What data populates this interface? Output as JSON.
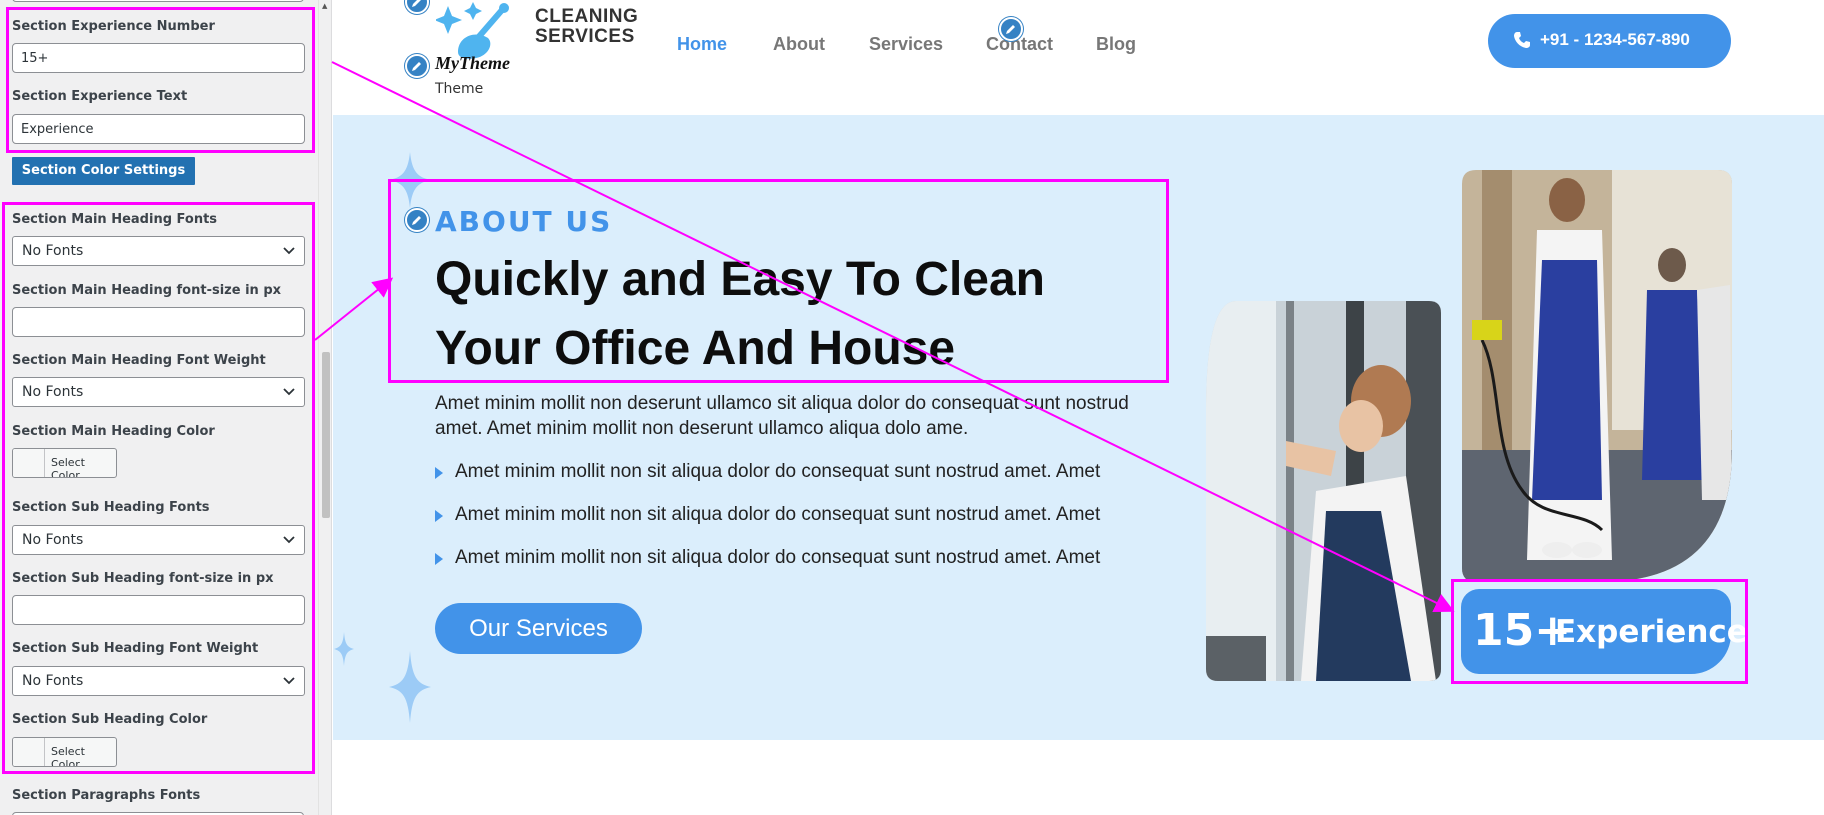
{
  "customizer": {
    "experience_number_label": "Section Experience Number",
    "experience_number_value": "15+",
    "experience_text_label": "Section Experience Text",
    "experience_text_value": "Experience",
    "color_settings_button": "Section Color Settings",
    "main_heading_fonts_label": "Section Main Heading Fonts",
    "main_heading_fonts_value": "No Fonts",
    "main_heading_size_label": "Section Main Heading font-size in px",
    "main_heading_size_value": "",
    "main_heading_weight_label": "Section Main Heading Font Weight",
    "main_heading_weight_value": "No Fonts",
    "main_heading_color_label": "Section Main Heading Color",
    "select_color_label": "Select Color",
    "sub_heading_fonts_label": "Section Sub Heading Fonts",
    "sub_heading_fonts_value": "No Fonts",
    "sub_heading_size_label": "Section Sub Heading font-size in px",
    "sub_heading_size_value": "",
    "sub_heading_weight_label": "Section Sub Heading Font Weight",
    "sub_heading_weight_value": "No Fonts",
    "sub_heading_color_label": "Section Sub Heading Color",
    "paragraphs_fonts_label": "Section Paragraphs Fonts"
  },
  "header": {
    "brand_line1": "CLEANING",
    "brand_line2": "SERVICES",
    "site_name": "MyTheme",
    "tagline": "Theme",
    "nav": [
      "Home",
      "About",
      "Services",
      "Contact",
      "Blog"
    ],
    "active_nav": "Home",
    "phone": "+91 - 1234-567-890"
  },
  "about": {
    "kicker": "ABOUT US",
    "title": "Quickly and Easy To Clean Your Office And House",
    "paragraph": "Amet minim mollit non deserunt ullamco sit aliqua dolor do consequat sunt nostrud amet. Amet minim mollit non deserunt ullamco aliqua dolo ame.",
    "bullets": [
      "Amet minim mollit non sit aliqua dolor do consequat sunt nostrud amet. Amet",
      "Amet minim mollit non sit aliqua dolor do consequat sunt nostrud amet. Amet",
      "Amet minim mollit non sit aliqua dolor do consequat sunt nostrud amet. Amet"
    ],
    "cta": "Our Services",
    "experience_number": "15+",
    "experience_text": "Experience"
  },
  "colors": {
    "accent": "#4293e9",
    "about_bg": "#dbeefc",
    "highlight": "#ff00ff",
    "wp_blue": "#2271b1"
  }
}
